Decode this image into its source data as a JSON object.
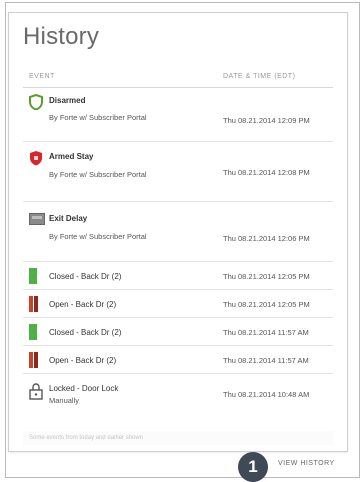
{
  "title": "History",
  "columns": {
    "event": "EVENT",
    "date": "DATE & TIME (EDT)"
  },
  "rows": [
    {
      "icon": "shield-disarmed-icon",
      "event": "Disarmed",
      "sub": "By Forte w/ Subscriber Portal",
      "date": "Thu 08.21.2014 12:09 PM",
      "color": "#5aa02c"
    },
    {
      "icon": "shield-armed-icon",
      "event": "Armed Stay",
      "sub": "By Forte w/ Subscriber Portal",
      "date": "Thu 08.21.2014 12:08 PM",
      "color": "#d9262c"
    },
    {
      "icon": "panel-icon",
      "event": "Exit Delay",
      "sub": "By Forte w/ Subscriber Portal",
      "date": "Thu 08.21.2014 12:06 PM",
      "color": "#7f7f7f"
    },
    {
      "icon": "door-closed-icon",
      "event": "Closed - Back Dr (2)",
      "sub": "",
      "date": "Thu 08.21.2014 12:05 PM",
      "color": "#4fb046"
    },
    {
      "icon": "door-open-icon",
      "event": "Open - Back Dr (2)",
      "sub": "",
      "date": "Thu 08.21.2014 12:05 PM",
      "color": "#c9442b"
    },
    {
      "icon": "door-closed-icon",
      "event": "Closed - Back Dr (2)",
      "sub": "",
      "date": "Thu 08.21.2014 11:57 AM",
      "color": "#4fb046"
    },
    {
      "icon": "door-open-icon",
      "event": "Open - Back Dr (2)",
      "sub": "",
      "date": "Thu 08.21.2014 11:57 AM",
      "color": "#c9442b"
    },
    {
      "icon": "lock-icon",
      "event": "Locked - Door Lock",
      "sub": "Manually",
      "date": "Thu 08.21.2014 10:48 AM",
      "color": "#555555"
    }
  ],
  "footer_note": "Some events from today and earlier shown",
  "view_history": "VIEW HISTORY",
  "callout": "1"
}
